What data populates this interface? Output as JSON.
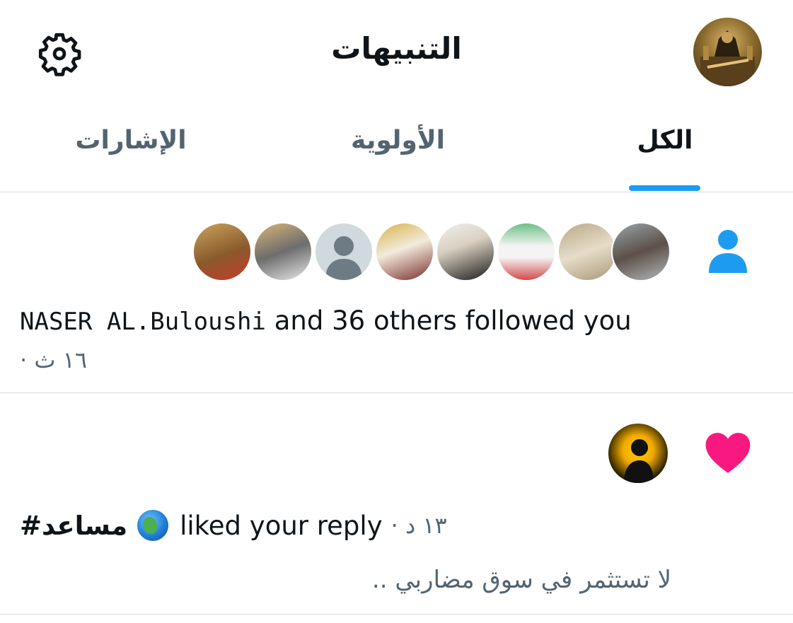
{
  "header": {
    "title": "التنبيهات",
    "settings_icon": "gear-icon",
    "profile_avatar": "profile-avatar"
  },
  "tabs": [
    {
      "label": "الكل",
      "active": true
    },
    {
      "label": "الأولوية",
      "active": false
    },
    {
      "label": "الإشارات",
      "active": false
    }
  ],
  "notifications": {
    "follow": {
      "icon": "person-icon",
      "name": "NASER AL.Buloushi",
      "text": " and 36 others followed you",
      "time": "١٦ ث ·"
    },
    "like": {
      "icon": "heart-icon",
      "actor": "#مساعد",
      "text": "liked your reply",
      "time": "· ١٣ د",
      "reply": "لا تستثمر في سوق مضاربي .."
    }
  },
  "colors": {
    "accent": "#1d9bf0",
    "like": "#f91880",
    "text_primary": "#0f1419",
    "text_secondary": "#536471",
    "divider": "#d5d9dc"
  }
}
